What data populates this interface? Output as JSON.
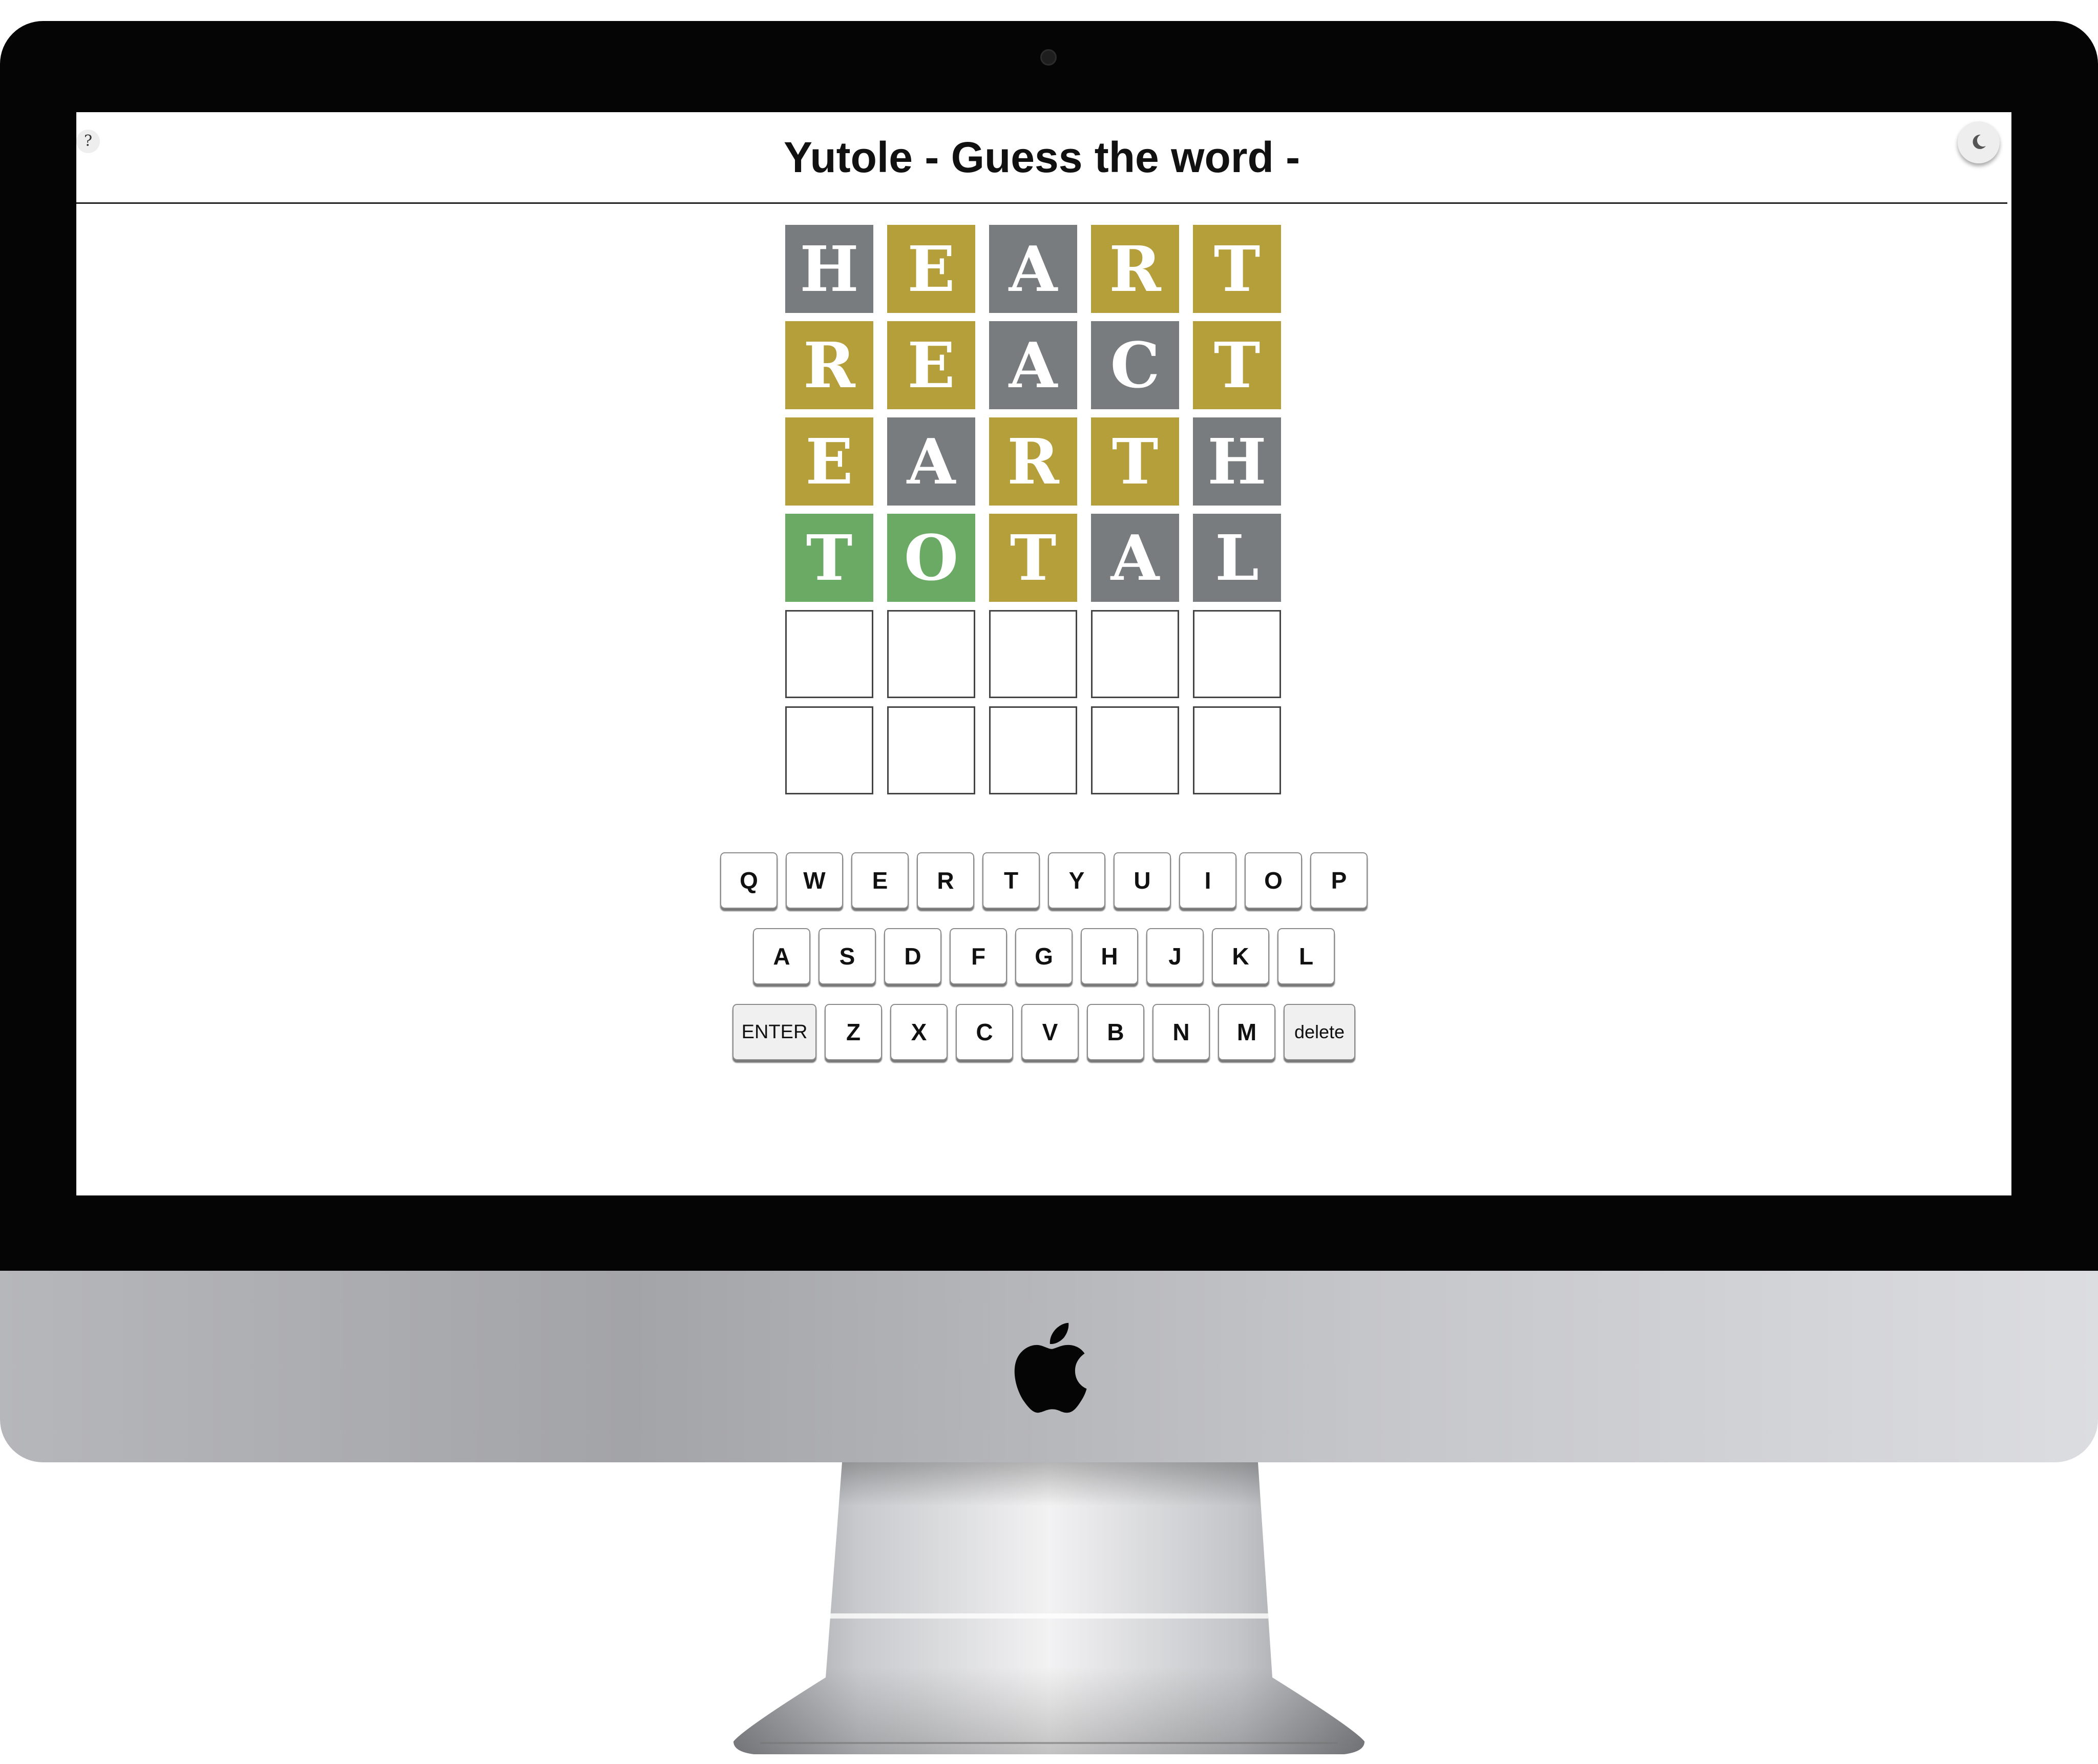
{
  "header": {
    "help_label": "?",
    "title": "Yutole - Guess the word -",
    "theme_icon": "moon-icon"
  },
  "colors": {
    "correct": "#6aaa64",
    "present": "#b59f3b",
    "absent": "#787c7e"
  },
  "board": {
    "rows": [
      [
        {
          "letter": "H",
          "state": "absent"
        },
        {
          "letter": "E",
          "state": "present"
        },
        {
          "letter": "A",
          "state": "absent"
        },
        {
          "letter": "R",
          "state": "present"
        },
        {
          "letter": "T",
          "state": "present"
        }
      ],
      [
        {
          "letter": "R",
          "state": "present"
        },
        {
          "letter": "E",
          "state": "present"
        },
        {
          "letter": "A",
          "state": "absent"
        },
        {
          "letter": "C",
          "state": "absent"
        },
        {
          "letter": "T",
          "state": "present"
        }
      ],
      [
        {
          "letter": "E",
          "state": "present"
        },
        {
          "letter": "A",
          "state": "absent"
        },
        {
          "letter": "R",
          "state": "present"
        },
        {
          "letter": "T",
          "state": "present"
        },
        {
          "letter": "H",
          "state": "absent"
        }
      ],
      [
        {
          "letter": "T",
          "state": "correct"
        },
        {
          "letter": "O",
          "state": "correct"
        },
        {
          "letter": "T",
          "state": "present"
        },
        {
          "letter": "A",
          "state": "absent"
        },
        {
          "letter": "L",
          "state": "absent"
        }
      ],
      [
        {
          "letter": "",
          "state": "empty"
        },
        {
          "letter": "",
          "state": "empty"
        },
        {
          "letter": "",
          "state": "empty"
        },
        {
          "letter": "",
          "state": "empty"
        },
        {
          "letter": "",
          "state": "empty"
        }
      ],
      [
        {
          "letter": "",
          "state": "empty"
        },
        {
          "letter": "",
          "state": "empty"
        },
        {
          "letter": "",
          "state": "empty"
        },
        {
          "letter": "",
          "state": "empty"
        },
        {
          "letter": "",
          "state": "empty"
        }
      ]
    ]
  },
  "keyboard": {
    "rows": [
      [
        "Q",
        "W",
        "E",
        "R",
        "T",
        "Y",
        "U",
        "I",
        "O",
        "P"
      ],
      [
        "A",
        "S",
        "D",
        "F",
        "G",
        "H",
        "J",
        "K",
        "L"
      ],
      [
        "ENTER",
        "Z",
        "X",
        "C",
        "V",
        "B",
        "N",
        "M",
        "delete"
      ]
    ]
  },
  "device": {
    "logo_icon": "apple-logo-icon",
    "camera_icon": "camera-icon"
  }
}
